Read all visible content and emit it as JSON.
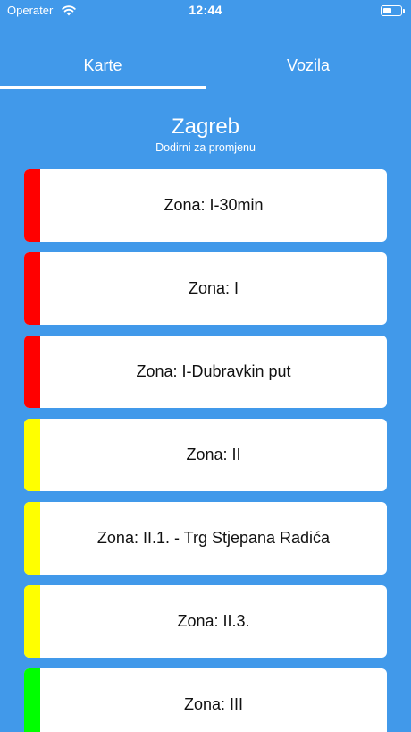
{
  "status_bar": {
    "carrier": "Operater",
    "time": "12:44",
    "wifi_icon": "wifi-icon",
    "battery_icon": "battery-icon",
    "battery_level": 0.55
  },
  "tabs": [
    {
      "label": "Karte",
      "selected": true
    },
    {
      "label": "Vozila",
      "selected": false
    }
  ],
  "city": {
    "name": "Zagreb",
    "hint": "Dodirni za promjenu"
  },
  "colors": {
    "background": "#4199ea",
    "red": "#ff0000",
    "yellow": "#ffff00",
    "green": "#00ff00"
  },
  "zones": [
    {
      "label": "Zona: I-30min",
      "color": "#ff0000"
    },
    {
      "label": "Zona: I",
      "color": "#ff0000"
    },
    {
      "label": "Zona: I-Dubravkin put",
      "color": "#ff0000"
    },
    {
      "label": "Zona: II",
      "color": "#ffff00"
    },
    {
      "label": "Zona: II.1. - Trg Stjepana Radića",
      "color": "#ffff00"
    },
    {
      "label": "Zona: II.3.",
      "color": "#ffff00"
    },
    {
      "label": "Zona: III",
      "color": "#00ff00"
    }
  ]
}
